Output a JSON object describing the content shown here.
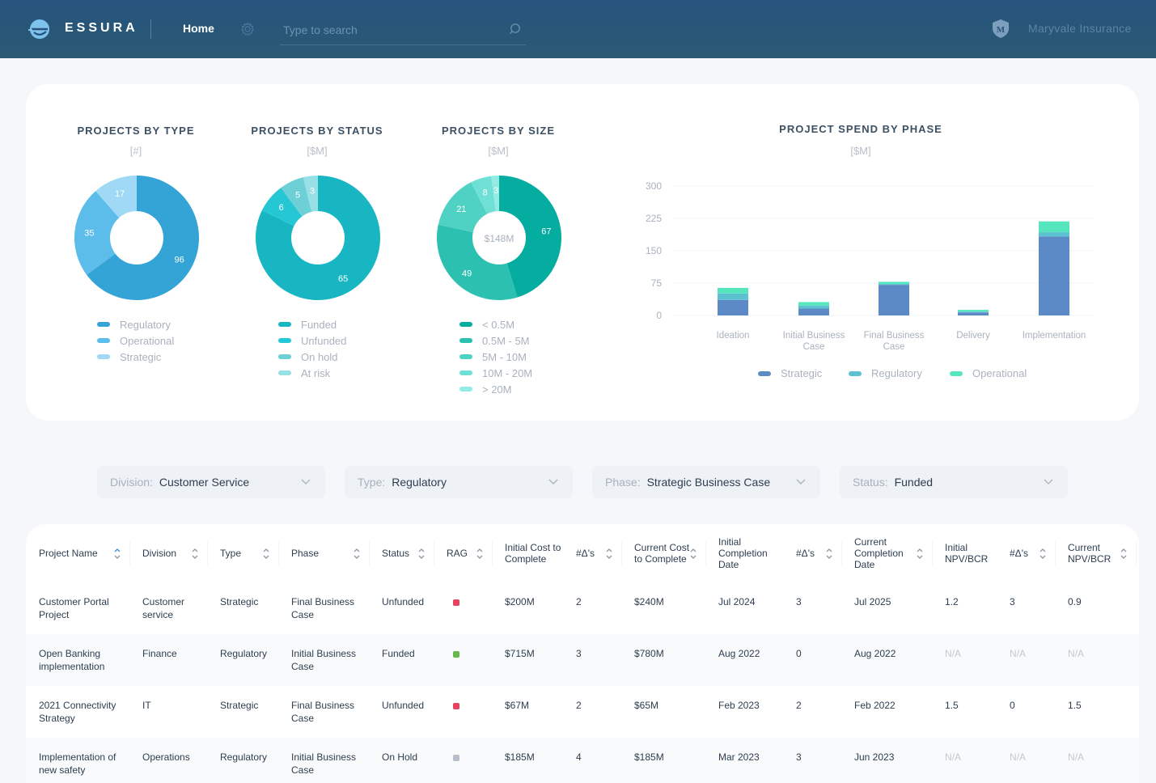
{
  "header": {
    "brand": "ESSURA",
    "nav_home": "Home",
    "search_placeholder": "Type to search",
    "org_name": "Maryvale Insurance",
    "icons": [
      "essura-logo-icon",
      "gear-icon",
      "search-icon",
      "shield-m-icon"
    ]
  },
  "donuts": [
    {
      "title": "PROJECTS BY TYPE",
      "unit": "[#]",
      "center_label": "",
      "slices": [
        {
          "label": "Regulatory",
          "value": 96,
          "color": "#34a3d6"
        },
        {
          "label": "Operational",
          "value": 35,
          "color": "#5cbdeb"
        },
        {
          "label": "Strategic",
          "value": 17,
          "color": "#9fd9f5"
        }
      ]
    },
    {
      "title": "PROJECTS BY STATUS",
      "unit": "[$M]",
      "center_label": "",
      "slices": [
        {
          "label": "Funded",
          "value": 65,
          "color": "#17b6c2"
        },
        {
          "label": "Unfunded",
          "value": 6,
          "color": "#24c7d3"
        },
        {
          "label": "On hold",
          "value": 5,
          "color": "#6dd0d6"
        },
        {
          "label": "At risk",
          "value": 3,
          "color": "#97e0e5"
        }
      ]
    },
    {
      "title": "PROJECTS BY SIZE",
      "unit": "[$M]",
      "center_label": "$148M",
      "slices": [
        {
          "label": "< 0.5M",
          "value": 67,
          "color": "#04ad9f"
        },
        {
          "label": "0.5M - 5M",
          "value": 49,
          "color": "#2cc0b1"
        },
        {
          "label": "5M - 10M",
          "value": 21,
          "color": "#4fd2c4"
        },
        {
          "label": "10M - 20M",
          "value": 8,
          "color": "#6fe0d6"
        },
        {
          "label": "> 20M",
          "value": 3,
          "color": "#93ebe4"
        }
      ]
    }
  ],
  "chart_data": {
    "type": "bar",
    "stacked": true,
    "title": "PROJECT SPEND BY PHASE",
    "subtitle": "[$M]",
    "xlabel": "",
    "ylabel": "",
    "ylim": [
      0,
      300
    ],
    "yticks": [
      0,
      75,
      150,
      225,
      300
    ],
    "grid": true,
    "legend_position": "bottom",
    "categories": [
      "Ideation",
      "Initial Business Case",
      "Final Business Case",
      "Delivery",
      "Implementation"
    ],
    "series": [
      {
        "name": "Strategic",
        "color": "#5b8ac6",
        "values": [
          36,
          16,
          71,
          7,
          183
        ]
      },
      {
        "name": "Regulatory",
        "color": "#5cc2d2",
        "values": [
          15,
          7,
          2,
          2,
          10
        ]
      },
      {
        "name": "Operational",
        "color": "#56e6bd",
        "values": [
          13,
          8,
          5,
          4,
          25
        ]
      }
    ]
  },
  "filters": [
    {
      "label": "Division:",
      "value": "Customer Service"
    },
    {
      "label": "Type:",
      "value": "Regulatory"
    },
    {
      "label": "Phase:",
      "value": "Strategic Business Case"
    },
    {
      "label": "Status:",
      "value": "Funded"
    }
  ],
  "table": {
    "columns": [
      "Project Name",
      "Division",
      "Type",
      "Phase",
      "Status",
      "RAG",
      "Initial Cost to Complete",
      "#Δ's",
      "Current Cost to Complete",
      "Initial Completion Date",
      "#Δ's",
      "Current Completion Date",
      "Initial NPV/BCR",
      "#Δ's",
      "Current NPV/BCR"
    ],
    "active_sort_column": "Project Name",
    "rows": [
      {
        "cells": [
          "Customer Portal Project",
          "Customer service",
          "Strategic",
          "Final Business Case",
          "Unfunded",
          "red",
          "$200M",
          "2",
          "$240M",
          "Jul 2024",
          "3",
          "Jul 2025",
          "1.2",
          "3",
          "0.9"
        ]
      },
      {
        "cells": [
          "Open Banking implementation",
          "Finance",
          "Regulatory",
          "Initial Business Case",
          "Funded",
          "green",
          "$715M",
          "3",
          "$780M",
          "Aug 2022",
          "0",
          "Aug 2022",
          "N/A",
          "N/A",
          "N/A"
        ]
      },
      {
        "cells": [
          "2021 Connectivity Strategy",
          "IT",
          "Strategic",
          "Final Business Case",
          "Unfunded",
          "red",
          "$67M",
          "2",
          "$65M",
          "Feb 2023",
          "2",
          "Feb 2022",
          "1.5",
          "0",
          "1.5"
        ]
      },
      {
        "cells": [
          "Implementation of new safety",
          "Operations",
          "Regulatory",
          "Initial Business Case",
          "On Hold",
          "grey",
          "$185M",
          "4",
          "$185M",
          "Mar 2023",
          "3",
          "Jun 2023",
          "N/A",
          "N/A",
          "N/A"
        ]
      }
    ],
    "rag_colors": {
      "red": "#e5455f",
      "green": "#67b84b",
      "grey": "#b9bfc8"
    }
  }
}
